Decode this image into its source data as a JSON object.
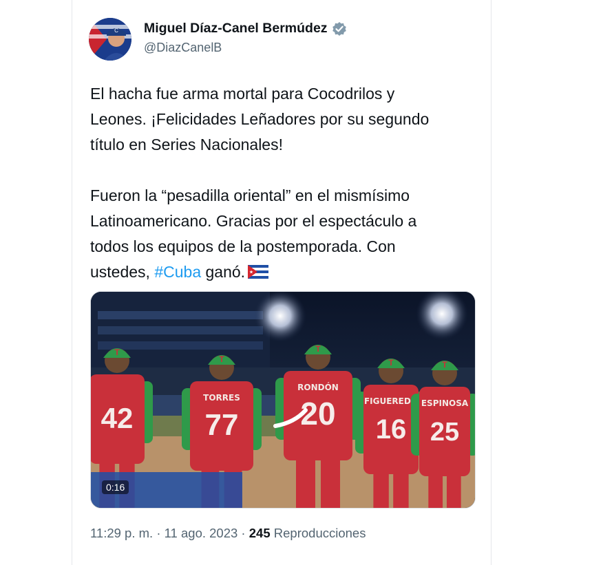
{
  "author": {
    "name": "Miguel Díaz-Canel Bermúdez",
    "handle": "@DiazCanelB",
    "verified_icon": "verified-badge-icon"
  },
  "tweet": {
    "line1": "El hacha fue arma mortal para Cocodrilos y",
    "line2": "Leones. ¡Felicidades Leñadores por su segundo",
    "line3": "título en Series Nacionales!",
    "line4": "Fueron la “pesadilla oriental” en el mismísimo",
    "line5": "Latinoamericano. Gracias por el espectáculo a",
    "line6": "todos los equipos de la postemporada. Con",
    "line7_pre": "ustedes, ",
    "hashtag": "#Cuba",
    "line7_post": " ganó.",
    "flag_icon": "cuba-flag-icon"
  },
  "media": {
    "duration": "0:16",
    "jerseys": [
      {
        "name": "",
        "number": "42"
      },
      {
        "name": "TORRES",
        "number": "77"
      },
      {
        "name": "RONDÓN",
        "number": "20"
      },
      {
        "name": "FIGUEREDO",
        "number": "16"
      },
      {
        "name": "ESPINOSA",
        "number": "25"
      }
    ],
    "cap_letter": "T"
  },
  "meta": {
    "time": "11:29 p. m.",
    "sep1": " · ",
    "date": "11 ago. 2023",
    "sep2": " · ",
    "views_count": "245",
    "views_label": " Reproducciones"
  },
  "colors": {
    "text": "#0f1419",
    "secondary": "#536471",
    "link": "#1d9bf0",
    "jersey_red": "#c9303a",
    "jersey_green": "#2f9a4a"
  }
}
